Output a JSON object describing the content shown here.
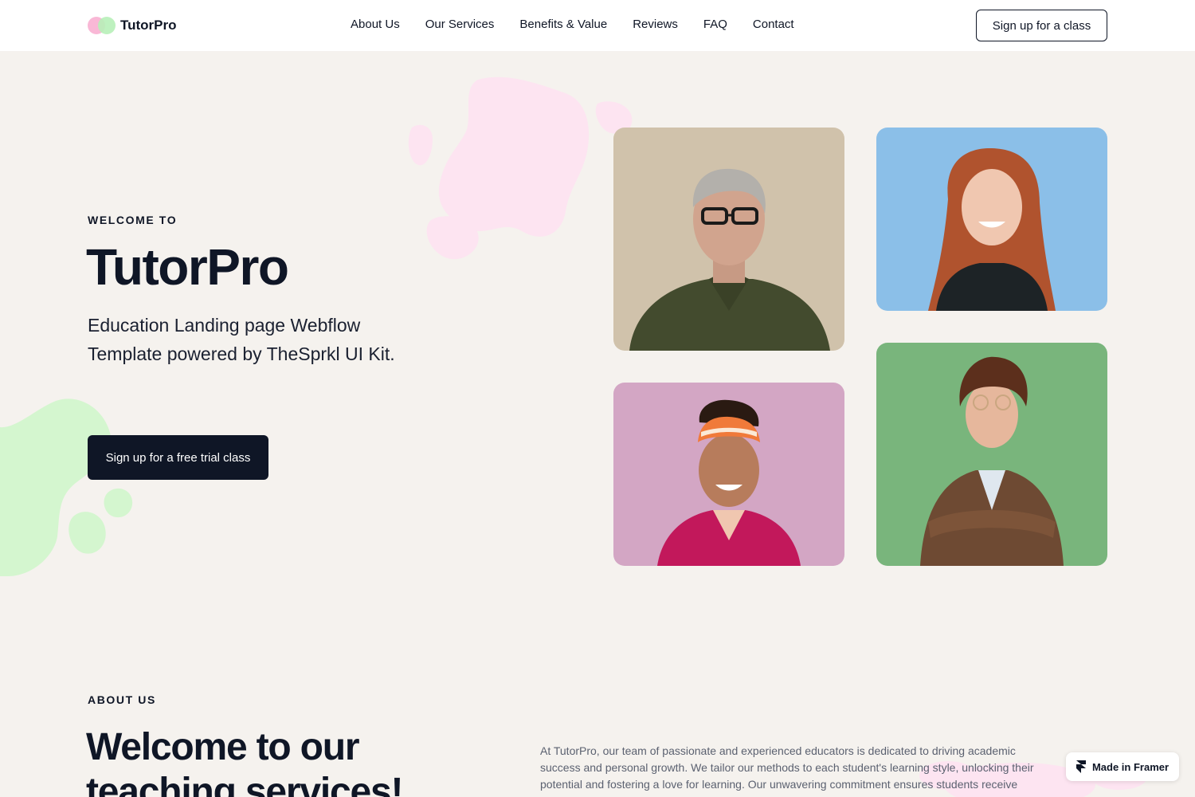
{
  "nav": {
    "logo_text": "TutorPro",
    "links": [
      "About Us",
      "Our Services",
      "Benefits & Value",
      "Reviews",
      "FAQ",
      "Contact"
    ],
    "cta_label": "Sign up for a class"
  },
  "hero": {
    "eyebrow": "WELCOME TO",
    "title": "TutorPro",
    "subtitle": "Education Landing page Webflow Template powered by TheSprkl UI Kit.",
    "cta_label": "Sign up for a free trial class"
  },
  "about": {
    "eyebrow": "ABOUT US",
    "title": "Welcome to our teaching services!",
    "text": "At TutorPro, our team of passionate and experienced educators is dedicated to driving academic success and personal growth. We tailor our methods to each student's learning style, unlocking their potential and fostering a love for learning. Our unwavering commitment ensures students receive the quality education they deserve."
  },
  "badge": {
    "label": "Made in Framer"
  },
  "colors": {
    "background": "#f5f2ee",
    "dark": "#0f1626",
    "pink_blob": "#fde4f1",
    "green_blob": "#d4f6cf",
    "card_beige": "#d0c2ab",
    "card_blue": "#8bbfe8",
    "card_pink": "#d3a6c4",
    "card_green": "#79b57c"
  },
  "icons": [
    "framer-logo-icon"
  ]
}
